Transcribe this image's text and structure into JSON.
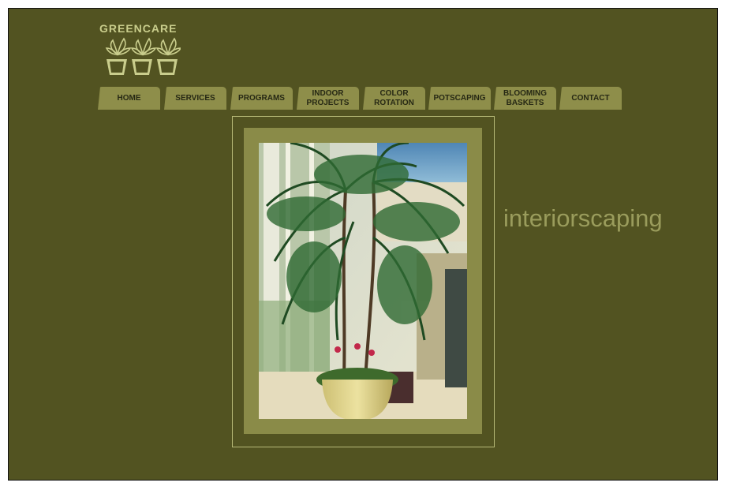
{
  "brand": {
    "name": "GREENCARE",
    "logo_icon": "potted-plants-icon"
  },
  "nav": {
    "items": [
      {
        "label": "HOME"
      },
      {
        "label": "SERVICES"
      },
      {
        "label": "PROGRAMS"
      },
      {
        "label": "INDOOR\nPROJECTS"
      },
      {
        "label": "COLOR\nROTATION"
      },
      {
        "label": "POTSCAPING"
      },
      {
        "label": "BLOOMING\nBASKETS"
      },
      {
        "label": "CONTACT"
      }
    ]
  },
  "main": {
    "photo_subject": "palm-in-lobby-photo",
    "tagline": "interiorscaping"
  },
  "colors": {
    "background": "#525321",
    "tab": "#8e8e4a",
    "logo": "#c9cd8c",
    "tagline": "#9a9c5c"
  }
}
